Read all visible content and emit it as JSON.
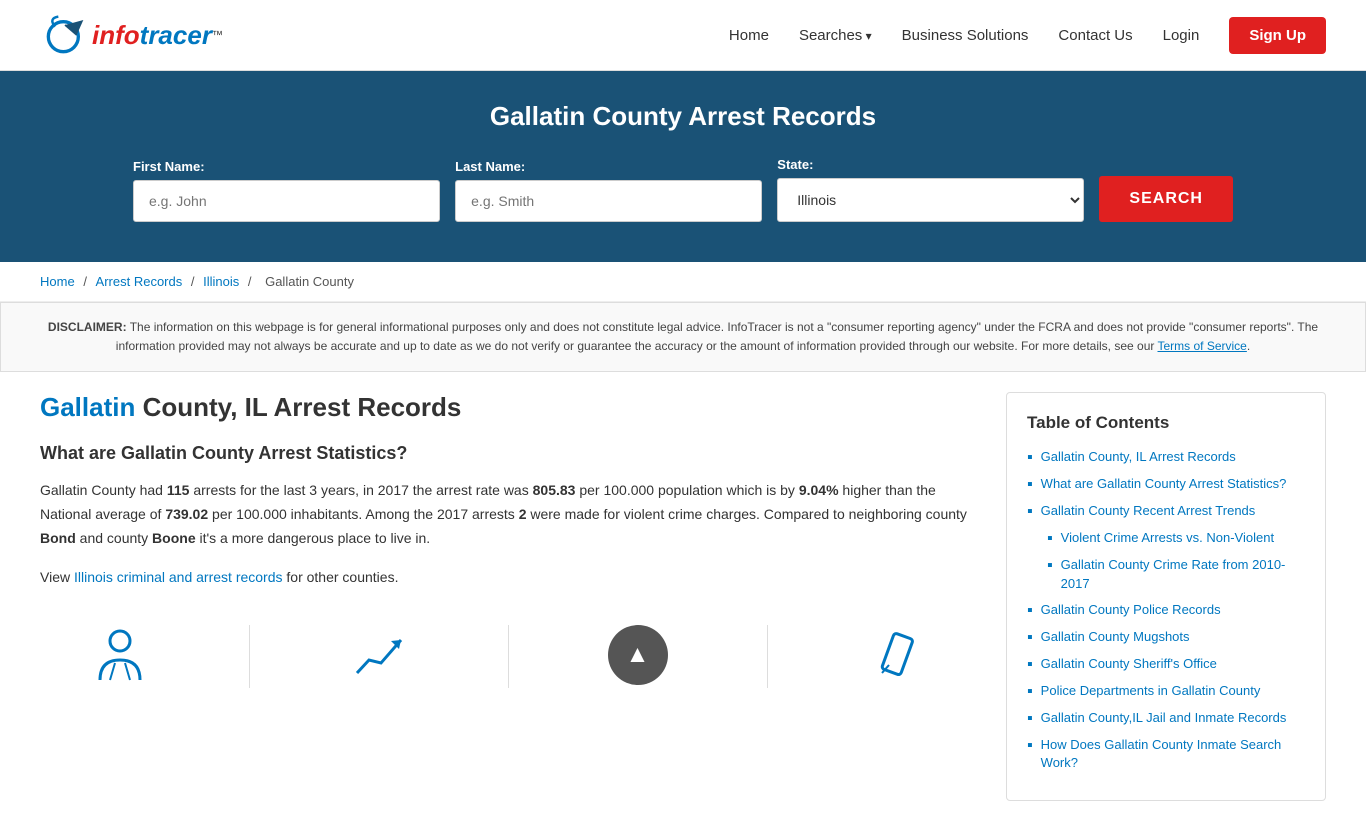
{
  "header": {
    "logo_text_red": "info",
    "logo_text_blue": "tracer",
    "logo_tm": "™",
    "nav": {
      "home": "Home",
      "searches": "Searches",
      "business_solutions": "Business Solutions",
      "contact_us": "Contact Us",
      "login": "Login",
      "signup": "Sign Up"
    }
  },
  "hero": {
    "title": "Gallatin County Arrest Records",
    "form": {
      "first_name_label": "First Name:",
      "first_name_placeholder": "e.g. John",
      "last_name_label": "Last Name:",
      "last_name_placeholder": "e.g. Smith",
      "state_label": "State:",
      "state_value": "Illinois",
      "search_button": "SEARCH"
    }
  },
  "breadcrumb": {
    "home": "Home",
    "arrest_records": "Arrest Records",
    "illinois": "Illinois",
    "gallatin_county": "Gallatin County"
  },
  "disclaimer": {
    "label": "DISCLAIMER:",
    "text": "The information on this webpage is for general informational purposes only and does not constitute legal advice. InfoTracer is not a \"consumer reporting agency\" under the FCRA and does not provide \"consumer reports\". The information provided may not always be accurate and up to date as we do not verify or guarantee the accuracy or the amount of information provided through our website. For more details, see our",
    "tos_link": "Terms of Service",
    "period": "."
  },
  "article": {
    "heading_highlight": "Gallatin",
    "heading_rest": " County, IL Arrest Records",
    "section1_title": "What are Gallatin County Arrest Statistics?",
    "section1_p1_before": "Gallatin County had ",
    "arrests": "115",
    "section1_p1_middle1": " arrests for the last 3 years, in 2017 the arrest rate was ",
    "rate": "805.83",
    "section1_p1_middle2": " per 100.000 population which is by ",
    "pct": "9.04%",
    "section1_p1_middle3": " higher than the National average of ",
    "national": "739.02",
    "section1_p1_middle4": " per 100.000 inhabitants. Among the 2017 arrests ",
    "violent": "2",
    "section1_p1_middle5": " were made for violent crime charges. Compared to neighboring county ",
    "county1": "Bond",
    "section1_p1_middle6": " and county ",
    "county2": "Boone",
    "section1_p1_end": " it's a more dangerous place to live in.",
    "section1_p2_before": "View ",
    "illinois_link": "Illinois criminal and arrest records",
    "section1_p2_after": " for other counties."
  },
  "toc": {
    "title": "Table of Contents",
    "items": [
      {
        "label": "Gallatin County, IL Arrest Records",
        "sub": false
      },
      {
        "label": "What are Gallatin County Arrest Statistics?",
        "sub": false
      },
      {
        "label": "Gallatin County Recent Arrest Trends",
        "sub": false
      },
      {
        "label": "Violent Crime Arrests vs. Non-Violent",
        "sub": true
      },
      {
        "label": "Gallatin County Crime Rate from 2010-2017",
        "sub": true
      },
      {
        "label": "Gallatin County Police Records",
        "sub": false
      },
      {
        "label": "Gallatin County Mugshots",
        "sub": false
      },
      {
        "label": "Gallatin County Sheriff's Office",
        "sub": false
      },
      {
        "label": "Police Departments in Gallatin County",
        "sub": false
      },
      {
        "label": "Gallatin County,IL Jail and Inmate Records",
        "sub": false
      },
      {
        "label": "How Does Gallatin County Inmate Search Work?",
        "sub": false
      }
    ]
  },
  "colors": {
    "primary_blue": "#0077c0",
    "primary_red": "#e02020",
    "hero_bg": "#1a5276"
  }
}
